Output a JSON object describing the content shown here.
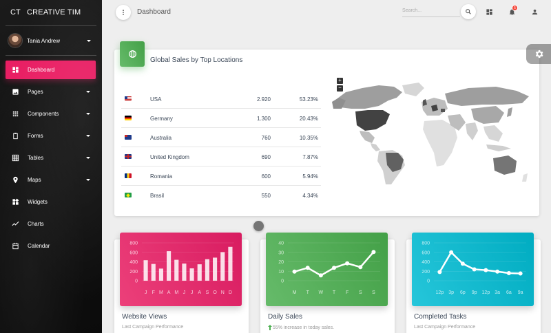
{
  "brand": {
    "mini": "CT",
    "name": "CREATIVE TIM"
  },
  "user": {
    "name": "Tania Andrew"
  },
  "nav": [
    {
      "label": "Dashboard",
      "icon": "dashboard-icon",
      "caret": false,
      "active": true
    },
    {
      "label": "Pages",
      "icon": "image-icon",
      "caret": true
    },
    {
      "label": "Components",
      "icon": "apps-icon",
      "caret": true
    },
    {
      "label": "Forms",
      "icon": "clipboard-icon",
      "caret": true
    },
    {
      "label": "Tables",
      "icon": "grid-icon",
      "caret": true
    },
    {
      "label": "Maps",
      "icon": "place-icon",
      "caret": true
    },
    {
      "label": "Widgets",
      "icon": "widgets-icon",
      "caret": false
    },
    {
      "label": "Charts",
      "icon": "timeline-icon",
      "caret": false
    },
    {
      "label": "Calendar",
      "icon": "calendar-icon",
      "caret": false
    }
  ],
  "topbar": {
    "title": "Dashboard",
    "search_placeholder": "Search...",
    "notifications": "5"
  },
  "sales": {
    "title": "Global Sales by Top Locations",
    "zoom_in": "+",
    "zoom_out": "−",
    "rows": [
      {
        "country": "USA",
        "value": "2.920",
        "pct": "53.23%",
        "flag": "us"
      },
      {
        "country": "Germany",
        "value": "1.300",
        "pct": "20.43%",
        "flag": "de"
      },
      {
        "country": "Australia",
        "value": "760",
        "pct": "10.35%",
        "flag": "au"
      },
      {
        "country": "United Kingdom",
        "value": "690",
        "pct": "7.87%",
        "flag": "gb"
      },
      {
        "country": "Romania",
        "value": "600",
        "pct": "5.94%",
        "flag": "ro"
      },
      {
        "country": "Brasil",
        "value": "550",
        "pct": "4.34%",
        "flag": "br"
      }
    ]
  },
  "cards": [
    {
      "title": "Website Views",
      "subtitle": "Last Campaign Performance",
      "color": "#e91e63"
    },
    {
      "title": "Daily Sales",
      "subtitle": "55% increase in today sales.",
      "color": "#4caf50"
    },
    {
      "title": "Completed Tasks",
      "subtitle": "Last Campaign Performance",
      "color": "#26c6da"
    }
  ],
  "chart_data": [
    {
      "type": "bar",
      "categories": [
        "J",
        "F",
        "M",
        "A",
        "M",
        "J",
        "J",
        "A",
        "S",
        "O",
        "N",
        "D"
      ],
      "values": [
        542,
        443,
        320,
        780,
        553,
        453,
        326,
        434,
        568,
        610,
        756,
        895
      ],
      "yticks": [
        "800",
        "600",
        "400",
        "200",
        "0"
      ],
      "ylim": [
        0,
        1000
      ]
    },
    {
      "type": "line",
      "categories": [
        "M",
        "T",
        "W",
        "T",
        "F",
        "S",
        "S"
      ],
      "values": [
        12,
        17,
        7,
        17,
        23,
        18,
        38
      ],
      "yticks": [
        "40",
        "30",
        "20",
        "10",
        "0"
      ],
      "ylim": [
        0,
        50
      ]
    },
    {
      "type": "line",
      "categories": [
        "12p",
        "3p",
        "6p",
        "9p",
        "12p",
        "3a",
        "6a",
        "9a"
      ],
      "values": [
        230,
        750,
        450,
        300,
        280,
        240,
        200,
        190
      ],
      "yticks": [
        "800",
        "600",
        "400",
        "200",
        "0"
      ],
      "ylim": [
        0,
        1000
      ]
    }
  ]
}
